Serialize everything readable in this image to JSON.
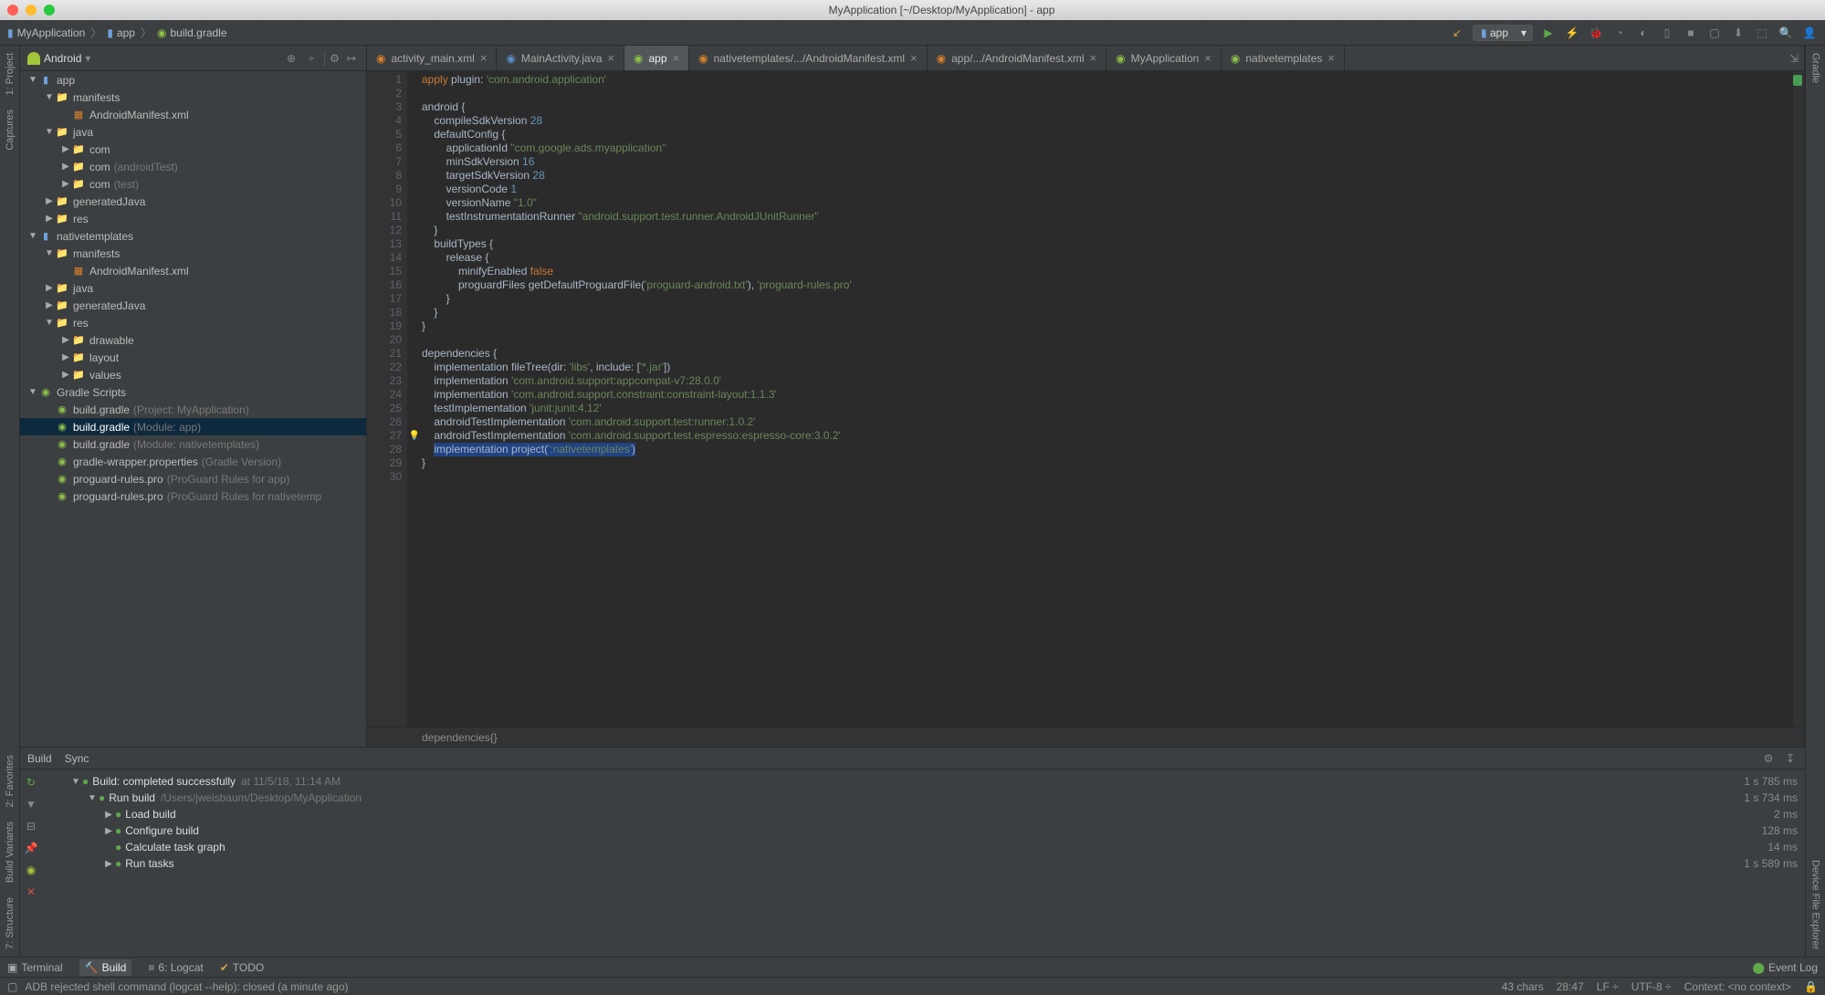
{
  "titlebar": {
    "title": "MyApplication [~/Desktop/MyApplication] - app"
  },
  "breadcrumbs": [
    {
      "label": "MyApplication"
    },
    {
      "label": "app"
    },
    {
      "label": "build.gradle"
    }
  ],
  "run_config": "app",
  "project_panel": {
    "view": "Android"
  },
  "tree": [
    {
      "indent": 0,
      "expand": "▼",
      "icon": "module",
      "label": "app"
    },
    {
      "indent": 1,
      "expand": "▼",
      "icon": "folder",
      "label": "manifests"
    },
    {
      "indent": 2,
      "expand": "",
      "icon": "xml",
      "label": "AndroidManifest.xml"
    },
    {
      "indent": 1,
      "expand": "▼",
      "icon": "folder",
      "label": "java"
    },
    {
      "indent": 2,
      "expand": "▶",
      "icon": "folder",
      "label": "com"
    },
    {
      "indent": 2,
      "expand": "▶",
      "icon": "folder",
      "label": "com",
      "dim": "(androidTest)"
    },
    {
      "indent": 2,
      "expand": "▶",
      "icon": "folder",
      "label": "com",
      "dim": "(test)"
    },
    {
      "indent": 1,
      "expand": "▶",
      "icon": "folder",
      "label": "generatedJava"
    },
    {
      "indent": 1,
      "expand": "▶",
      "icon": "folder",
      "label": "res"
    },
    {
      "indent": 0,
      "expand": "▼",
      "icon": "module",
      "label": "nativetemplates"
    },
    {
      "indent": 1,
      "expand": "▼",
      "icon": "folder",
      "label": "manifests"
    },
    {
      "indent": 2,
      "expand": "",
      "icon": "xml",
      "label": "AndroidManifest.xml"
    },
    {
      "indent": 1,
      "expand": "▶",
      "icon": "folder",
      "label": "java"
    },
    {
      "indent": 1,
      "expand": "▶",
      "icon": "folder",
      "label": "generatedJava"
    },
    {
      "indent": 1,
      "expand": "▼",
      "icon": "folder",
      "label": "res"
    },
    {
      "indent": 2,
      "expand": "▶",
      "icon": "folder",
      "label": "drawable"
    },
    {
      "indent": 2,
      "expand": "▶",
      "icon": "folder",
      "label": "layout"
    },
    {
      "indent": 2,
      "expand": "▶",
      "icon": "folder",
      "label": "values"
    },
    {
      "indent": 0,
      "expand": "▼",
      "icon": "gradle",
      "label": "Gradle Scripts"
    },
    {
      "indent": 1,
      "expand": "",
      "icon": "gradle",
      "label": "build.gradle",
      "dim": "(Project: MyApplication)"
    },
    {
      "indent": 1,
      "expand": "",
      "icon": "gradle",
      "label": "build.gradle",
      "dim": "(Module: app)",
      "selected": true
    },
    {
      "indent": 1,
      "expand": "",
      "icon": "gradle",
      "label": "build.gradle",
      "dim": "(Module: nativetemplates)"
    },
    {
      "indent": 1,
      "expand": "",
      "icon": "gradle",
      "label": "gradle-wrapper.properties",
      "dim": "(Gradle Version)"
    },
    {
      "indent": 1,
      "expand": "",
      "icon": "gradle",
      "label": "proguard-rules.pro",
      "dim": "(ProGuard Rules for app)"
    },
    {
      "indent": 1,
      "expand": "",
      "icon": "gradle",
      "label": "proguard-rules.pro",
      "dim": "(ProGuard Rules for nativetemp"
    }
  ],
  "tabs": [
    {
      "label": "activity_main.xml",
      "color": "#d9822b"
    },
    {
      "label": "MainActivity.java",
      "color": "#5b8fc7"
    },
    {
      "label": "app",
      "color": "#8cc04b",
      "active": true
    },
    {
      "label": "nativetemplates/.../AndroidManifest.xml",
      "color": "#d9822b"
    },
    {
      "label": "app/.../AndroidManifest.xml",
      "color": "#d9822b"
    },
    {
      "label": "MyApplication",
      "color": "#8cc04b"
    },
    {
      "label": "nativetemplates",
      "color": "#8cc04b"
    }
  ],
  "code_lines": [
    {
      "n": 1,
      "html": "<span class='kw'>apply</span> plugin: <span class='str'>'com.android.application'</span>"
    },
    {
      "n": 2,
      "html": ""
    },
    {
      "n": 3,
      "html": "android {"
    },
    {
      "n": 4,
      "html": "    compileSdkVersion <span class='num'>28</span>"
    },
    {
      "n": 5,
      "html": "    defaultConfig {"
    },
    {
      "n": 6,
      "html": "        applicationId <span class='str'>\"com.google.ads.myapplication\"</span>"
    },
    {
      "n": 7,
      "html": "        minSdkVersion <span class='num'>16</span>"
    },
    {
      "n": 8,
      "html": "        targetSdkVersion <span class='num'>28</span>"
    },
    {
      "n": 9,
      "html": "        versionCode <span class='num'>1</span>"
    },
    {
      "n": 10,
      "html": "        versionName <span class='str'>\"1.0\"</span>"
    },
    {
      "n": 11,
      "html": "        testInstrumentationRunner <span class='str'>\"android.support.test.runner.AndroidJUnitRunner\"</span>"
    },
    {
      "n": 12,
      "html": "    }"
    },
    {
      "n": 13,
      "html": "    buildTypes {"
    },
    {
      "n": 14,
      "html": "        release {"
    },
    {
      "n": 15,
      "html": "            minifyEnabled <span class='kw'>false</span>"
    },
    {
      "n": 16,
      "html": "            proguardFiles getDefaultProguardFile(<span class='str'>'proguard-android.txt'</span>), <span class='str'>'proguard-rules.pro'</span>"
    },
    {
      "n": 17,
      "html": "        }"
    },
    {
      "n": 18,
      "html": "    }"
    },
    {
      "n": 19,
      "html": "}"
    },
    {
      "n": 20,
      "html": ""
    },
    {
      "n": 21,
      "html": "dependencies {"
    },
    {
      "n": 22,
      "html": "    implementation fileTree(<span class='fn'>dir</span>: <span class='str'>'libs'</span>, <span class='fn'>include</span>: [<span class='str'>'*.jar'</span>])"
    },
    {
      "n": 23,
      "html": "    implementation <span class='str'>'com.android.support:appcompat-v7:28.0.0'</span>"
    },
    {
      "n": 24,
      "html": "    implementation <span class='str'>'com.android.support.constraint:constraint-layout:1.1.3'</span>"
    },
    {
      "n": 25,
      "html": "    testImplementation <span class='str'>'junit:junit:4.12'</span>"
    },
    {
      "n": 26,
      "html": "    androidTestImplementation <span class='str'>'com.android.support.test:runner:1.0.2'</span>"
    },
    {
      "n": 27,
      "html": "    androidTestImplementation <span class='str'>'com.android.support.test.espresso:espresso-core:3.0.2'</span>",
      "bulb": true
    },
    {
      "n": 28,
      "html": "    <span class='hl-line'>implementation project(<span class='str'>':nativetemplates'</span>)</span>"
    },
    {
      "n": 29,
      "html": "}"
    },
    {
      "n": 30,
      "html": ""
    }
  ],
  "editor_breadcrumb": "dependencies{}",
  "build": {
    "tabs": [
      "Build",
      "Sync"
    ],
    "rows": [
      {
        "indent": 0,
        "expand": "▼",
        "ok": true,
        "label": "Build:",
        "strong": "completed successfully",
        "path": "at 11/5/18, 11:14 AM",
        "time": "1 s 785 ms"
      },
      {
        "indent": 1,
        "expand": "▼",
        "ok": true,
        "label": "Run build",
        "path": "/Users/jweisbaum/Desktop/MyApplication",
        "time": "1 s 734 ms"
      },
      {
        "indent": 2,
        "expand": "▶",
        "ok": true,
        "label": "Load build",
        "time": "2 ms"
      },
      {
        "indent": 2,
        "expand": "▶",
        "ok": true,
        "label": "Configure build",
        "time": "128 ms"
      },
      {
        "indent": 2,
        "expand": "",
        "ok": true,
        "label": "Calculate task graph",
        "time": "14 ms"
      },
      {
        "indent": 2,
        "expand": "▶",
        "ok": true,
        "label": "Run tasks",
        "time": "1 s 589 ms"
      }
    ]
  },
  "bottom_tabs": {
    "terminal": "Terminal",
    "build": "Build",
    "logcat": "6: Logcat",
    "todo": "TODO",
    "event_log": "Event Log"
  },
  "left_rail": [
    "1: Project",
    "Captures",
    "2: Favorites",
    "Build Variants",
    "7: Structure"
  ],
  "right_rail": [
    "Gradle",
    "Device File Explorer"
  ],
  "status": {
    "message": "ADB rejected shell command (logcat --help): closed (a minute ago)",
    "chars": "43 chars",
    "pos": "28:47",
    "eol": "LF ÷",
    "encoding": "UTF-8 ÷",
    "context": "Context: <no context>"
  }
}
